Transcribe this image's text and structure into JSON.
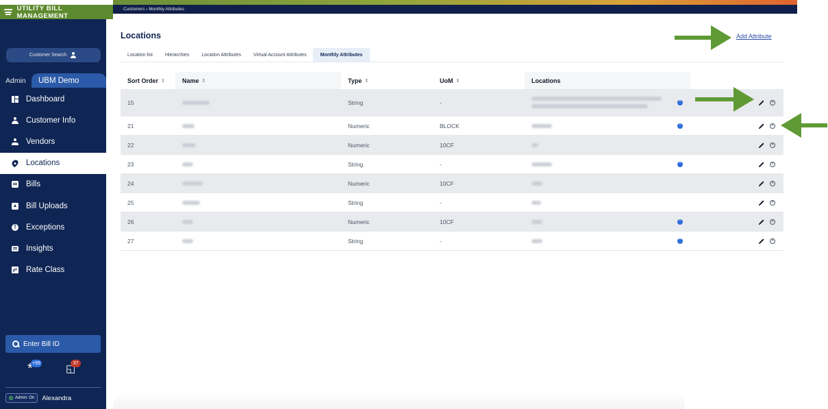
{
  "brand": {
    "title": "UTILITY BILL MANAGEMENT"
  },
  "breadcrumb": "Customers › Monthly Attributes",
  "sidebar": {
    "customer_search": "Customer Search",
    "admin_label": "Admin",
    "tenant": "UBM Demo",
    "items": [
      {
        "label": "Dashboard",
        "icon": "dashboard-icon"
      },
      {
        "label": "Customer Info",
        "icon": "person-icon"
      },
      {
        "label": "Vendors",
        "icon": "vendor-icon"
      },
      {
        "label": "Locations",
        "icon": "location-pin-icon",
        "active": true
      },
      {
        "label": "Bills",
        "icon": "bill-icon"
      },
      {
        "label": "Bill Uploads",
        "icon": "upload-icon"
      },
      {
        "label": "Exceptions",
        "icon": "exclamation-icon"
      },
      {
        "label": "Insights",
        "icon": "insights-icon"
      },
      {
        "label": "Rate Class",
        "icon": "rate-class-icon"
      }
    ],
    "bill_id_placeholder": "Enter Bill ID",
    "badges": {
      "asterisk_count": "+99",
      "doc_count": "37"
    },
    "admin_toggle": "Admin: On",
    "user": "Alexandra"
  },
  "page": {
    "title": "Locations",
    "add_attribute": "Add Attribute",
    "tabs": [
      "Location list",
      "Hierarchies",
      "Location Attributes",
      "Virtual Account Attributes",
      "Monthly Attributes"
    ],
    "active_tab": "Monthly Attributes"
  },
  "table": {
    "columns": {
      "sort_order": "Sort Order",
      "name": "Name",
      "type": "Type",
      "uom": "UoM",
      "locations": "Locations"
    },
    "rows": [
      {
        "sort": "15",
        "type": "String",
        "uom": "-",
        "info": true
      },
      {
        "sort": "21",
        "type": "Numeric",
        "uom": "BLOCK",
        "info": true
      },
      {
        "sort": "22",
        "type": "Numeric",
        "uom": "10CF",
        "info": false
      },
      {
        "sort": "23",
        "type": "String",
        "uom": "-",
        "info": true
      },
      {
        "sort": "24",
        "type": "Numeric",
        "uom": "10CF",
        "info": false
      },
      {
        "sort": "25",
        "type": "String",
        "uom": "-",
        "info": false
      },
      {
        "sort": "26",
        "type": "Numeric",
        "uom": "10CF",
        "info": true
      },
      {
        "sort": "27",
        "type": "String",
        "uom": "-",
        "info": true
      }
    ]
  },
  "colors": {
    "sidebar": "#0f2554",
    "brand_green": "#5d8a2e",
    "accent_blue": "#2b5aa8",
    "arrow_green": "#5f9a35",
    "info_blue": "#2d6fdc"
  }
}
